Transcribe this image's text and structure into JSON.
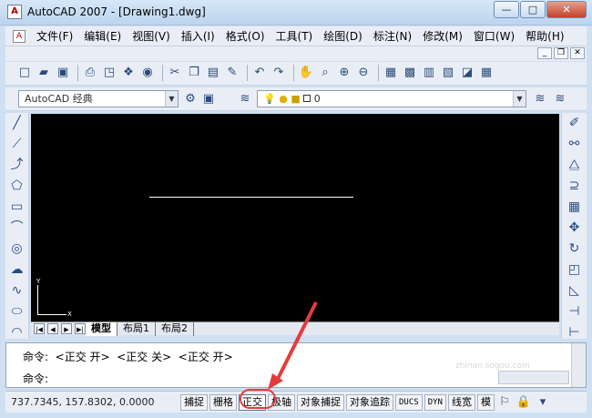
{
  "window": {
    "title": "AutoCAD 2007 - [Drawing1.dwg]",
    "app_icon": "A",
    "buttons": {
      "minimize": "—",
      "maximize": "□",
      "close": "✕"
    }
  },
  "menu": {
    "doc_icon": "A",
    "items": [
      "文件(F)",
      "编辑(E)",
      "视图(V)",
      "插入(I)",
      "格式(O)",
      "工具(T)",
      "绘图(D)",
      "标注(N)",
      "修改(M)",
      "窗口(W)",
      "帮助(H)"
    ]
  },
  "doc_controls": {
    "minimize": "_",
    "restore": "❐",
    "close": "✕"
  },
  "toolbar_standard": {
    "icons": [
      "new-icon",
      "open-icon",
      "save-icon",
      "plot-icon",
      "plot-preview-icon",
      "publish-icon",
      "3d-dwf-icon",
      "cut-icon",
      "copy-icon",
      "paste-icon",
      "match-properties-icon",
      "undo-icon",
      "redo-icon",
      "pan-icon",
      "zoom-realtime-icon",
      "zoom-window-icon",
      "zoom-previous-icon",
      "properties-icon",
      "design-center-icon",
      "tool-palettes-icon",
      "sheet-set-icon",
      "markup-icon",
      "calculator-icon"
    ]
  },
  "toolbar_styles": {
    "workspace_value": "AutoCAD 经典",
    "layer_value": "0"
  },
  "draw_tools": [
    "line-icon",
    "construction-line-icon",
    "polyline-icon",
    "polygon-icon",
    "rectangle-icon",
    "arc-icon",
    "circle-icon",
    "revision-cloud-icon",
    "spline-icon",
    "ellipse-icon",
    "ellipse-arc-icon"
  ],
  "modify_tools": [
    "erase-icon",
    "copy-object-icon",
    "mirror-icon",
    "offset-icon",
    "array-icon",
    "move-icon",
    "rotate-icon",
    "scale-icon",
    "stretch-icon",
    "trim-icon",
    "extend-icon"
  ],
  "canvas": {
    "ucs_x": "X",
    "ucs_y": "Y"
  },
  "layout_tabs": {
    "nav": [
      "|◀",
      "◀",
      "▶",
      "▶|"
    ],
    "tabs": [
      "模型",
      "布局1",
      "布局2"
    ],
    "active": "模型"
  },
  "command": {
    "history": "命令:  <正交 开>  <正交 关>  <正交 开>",
    "prompt": "命令:"
  },
  "status": {
    "coords": "737.7345,  157.8302,  0.0000",
    "buttons": [
      {
        "label": "捕捉",
        "on": false
      },
      {
        "label": "栅格",
        "on": false
      },
      {
        "label": "正交",
        "on": true
      },
      {
        "label": "极轴",
        "on": false
      },
      {
        "label": "对象捕捉",
        "on": false
      },
      {
        "label": "对象追踪",
        "on": false
      },
      {
        "label": "DUCS",
        "on": false
      },
      {
        "label": "DYN",
        "on": false
      },
      {
        "label": "线宽",
        "on": false
      },
      {
        "label": "模",
        "on": false
      }
    ]
  },
  "watermark": {
    "text": "搜狗指南",
    "sub": "zhinan.sogou.com"
  }
}
